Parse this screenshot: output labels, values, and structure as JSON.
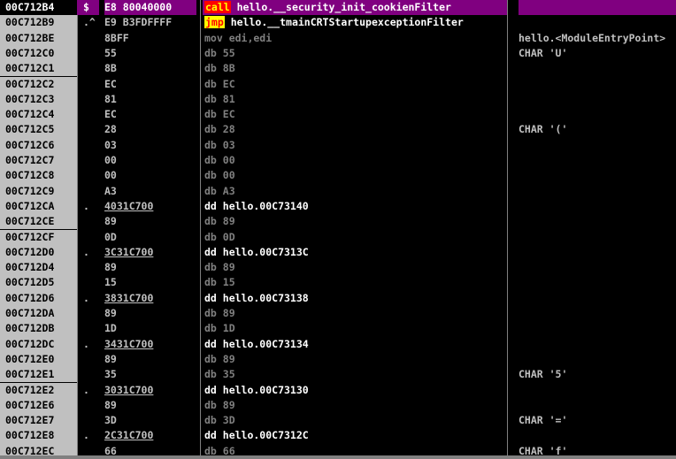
{
  "rows": [
    {
      "addr": "00C712B4",
      "mark": "$",
      "hex": "E8 80040000",
      "dis": "hello.__security_init_cookienFilter",
      "dis_kw": "call",
      "comment": "",
      "selected": true,
      "hex_ul": false,
      "dd": false
    },
    {
      "addr": "00C712B9",
      "mark": ".^",
      "hex": "E9 B3FDFFFF",
      "dis": "hello.__tmainCRTStartupexceptionFilter",
      "dis_kw": "jmp",
      "comment": "",
      "selected": false,
      "hex_ul": false,
      "dd": false
    },
    {
      "addr": "00C712BE",
      "mark": "",
      "hex": "8BFF",
      "dis": "mov edi,edi",
      "comment": "hello.<ModuleEntryPoint>",
      "hex_ul": false,
      "dd": false
    },
    {
      "addr": "00C712C0",
      "mark": "",
      "hex": "55",
      "dis": "db 55",
      "comment": "CHAR 'U'",
      "hex_ul": false,
      "dd": false
    },
    {
      "addr": "00C712C1",
      "mark": "",
      "hex": "8B",
      "dis": "db 8B",
      "comment": "",
      "hex_ul": false,
      "dd": false
    },
    {
      "addr": "00C712C2",
      "mark": "",
      "hex": "EC",
      "dis": "db EC",
      "comment": "",
      "hex_ul": false,
      "dd": false
    },
    {
      "addr": "00C712C3",
      "mark": "",
      "hex": "81",
      "dis": "db 81",
      "comment": "",
      "hex_ul": false,
      "dd": false
    },
    {
      "addr": "00C712C4",
      "mark": "",
      "hex": "EC",
      "dis": "db EC",
      "comment": "",
      "hex_ul": false,
      "dd": false
    },
    {
      "addr": "00C712C5",
      "mark": "",
      "hex": "28",
      "dis": "db 28",
      "comment": "CHAR '('",
      "hex_ul": false,
      "dd": false
    },
    {
      "addr": "00C712C6",
      "mark": "",
      "hex": "03",
      "dis": "db 03",
      "comment": "",
      "hex_ul": false,
      "dd": false
    },
    {
      "addr": "00C712C7",
      "mark": "",
      "hex": "00",
      "dis": "db 00",
      "comment": "",
      "hex_ul": false,
      "dd": false
    },
    {
      "addr": "00C712C8",
      "mark": "",
      "hex": "00",
      "dis": "db 00",
      "comment": "",
      "hex_ul": false,
      "dd": false
    },
    {
      "addr": "00C712C9",
      "mark": "",
      "hex": "A3",
      "dis": "db A3",
      "comment": "",
      "hex_ul": false,
      "dd": false
    },
    {
      "addr": "00C712CA",
      "mark": ".",
      "hex": "4031C700",
      "dis": "dd hello.00C73140",
      "comment": "",
      "hex_ul": true,
      "dd": true
    },
    {
      "addr": "00C712CE",
      "mark": "",
      "hex": "89",
      "dis": "db 89",
      "comment": "",
      "hex_ul": false,
      "dd": false
    },
    {
      "addr": "00C712CF",
      "mark": "",
      "hex": "0D",
      "dis": "db 0D",
      "comment": "",
      "hex_ul": false,
      "dd": false
    },
    {
      "addr": "00C712D0",
      "mark": ".",
      "hex": "3C31C700",
      "dis": "dd hello.00C7313C",
      "comment": "",
      "hex_ul": true,
      "dd": true
    },
    {
      "addr": "00C712D4",
      "mark": "",
      "hex": "89",
      "dis": "db 89",
      "comment": "",
      "hex_ul": false,
      "dd": false
    },
    {
      "addr": "00C712D5",
      "mark": "",
      "hex": "15",
      "dis": "db 15",
      "comment": "",
      "hex_ul": false,
      "dd": false
    },
    {
      "addr": "00C712D6",
      "mark": ".",
      "hex": "3831C700",
      "dis": "dd hello.00C73138",
      "comment": "",
      "hex_ul": true,
      "dd": true
    },
    {
      "addr": "00C712DA",
      "mark": "",
      "hex": "89",
      "dis": "db 89",
      "comment": "",
      "hex_ul": false,
      "dd": false
    },
    {
      "addr": "00C712DB",
      "mark": "",
      "hex": "1D",
      "dis": "db 1D",
      "comment": "",
      "hex_ul": false,
      "dd": false
    },
    {
      "addr": "00C712DC",
      "mark": ".",
      "hex": "3431C700",
      "dis": "dd hello.00C73134",
      "comment": "",
      "hex_ul": true,
      "dd": true
    },
    {
      "addr": "00C712E0",
      "mark": "",
      "hex": "89",
      "dis": "db 89",
      "comment": "",
      "hex_ul": false,
      "dd": false
    },
    {
      "addr": "00C712E1",
      "mark": "",
      "hex": "35",
      "dis": "db 35",
      "comment": "CHAR '5'",
      "hex_ul": false,
      "dd": false
    },
    {
      "addr": "00C712E2",
      "mark": ".",
      "hex": "3031C700",
      "dis": "dd hello.00C73130",
      "comment": "",
      "hex_ul": true,
      "dd": true
    },
    {
      "addr": "00C712E6",
      "mark": "",
      "hex": "89",
      "dis": "db 89",
      "comment": "",
      "hex_ul": false,
      "dd": false
    },
    {
      "addr": "00C712E7",
      "mark": "",
      "hex": "3D",
      "dis": "db 3D",
      "comment": "CHAR '='",
      "hex_ul": false,
      "dd": false
    },
    {
      "addr": "00C712E8",
      "mark": ".",
      "hex": "2C31C700",
      "dis": "dd hello.00C7312C",
      "comment": "",
      "hex_ul": true,
      "dd": true
    },
    {
      "addr": "00C712EC",
      "mark": "",
      "hex": "66",
      "dis": "db 66",
      "comment": "CHAR 'f'",
      "hex_ul": false,
      "dd": false
    }
  ]
}
